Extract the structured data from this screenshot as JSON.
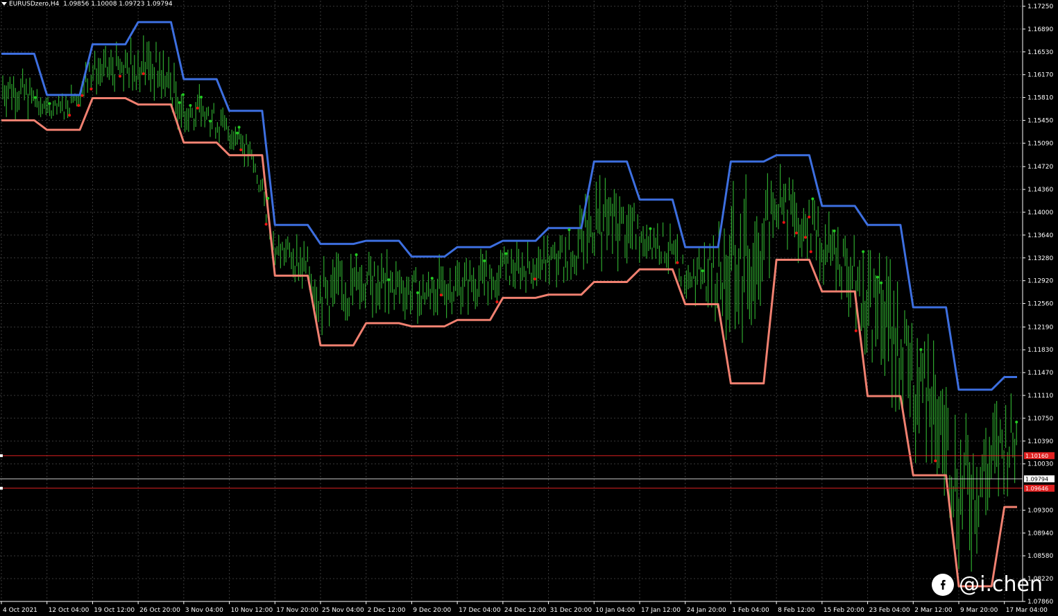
{
  "header": {
    "symbol_info": "EURUSDzero,H4",
    "ohlc": "1.09856 1.10008 1.09723 1.09794"
  },
  "colors": {
    "background": "#000000",
    "grid": "#3a3a3a",
    "upper_band": "#3d6fe0",
    "lower_band": "#f08070",
    "candles": "#2ea82e",
    "up_dot": "#22cc22",
    "down_dot": "#ee1111",
    "level_line": "#e02020",
    "current_line": "#c8c8c8"
  },
  "price_axis": {
    "labels": [
      "1.17250",
      "1.16890",
      "1.16530",
      "1.16170",
      "1.15810",
      "1.15450",
      "1.15090",
      "1.14720",
      "1.14360",
      "1.14000",
      "1.13640",
      "1.13280",
      "1.12920",
      "1.12560",
      "1.12190",
      "1.11830",
      "1.11470",
      "1.11110",
      "1.10750",
      "1.10390",
      "1.10030",
      "1.09300",
      "1.08940",
      "1.08580",
      "1.08220",
      "1.07860"
    ]
  },
  "time_axis": {
    "labels": [
      "4 Oct 2021",
      "12 Oct 04:00",
      "19 Oct 12:00",
      "26 Oct 20:00",
      "3 Nov 04:00",
      "10 Nov 12:00",
      "17 Nov 20:00",
      "25 Nov 04:00",
      "2 Dec 12:00",
      "9 Dec 20:00",
      "17 Dec 04:00",
      "24 Dec 12:00",
      "31 Dec 20:00",
      "10 Jan 04:00",
      "17 Jan 12:00",
      "24 Jan 20:00",
      "1 Feb 04:00",
      "8 Feb 12:00",
      "15 Feb 20:00",
      "23 Feb 04:00",
      "2 Mar 12:00",
      "9 Mar 20:00",
      "17 Mar 04:00"
    ]
  },
  "price_tags": {
    "resistance": "1.10160",
    "current": "1.09794",
    "support": "1.09646"
  },
  "watermark": {
    "text": "@i.chen",
    "icon": "facebook-icon"
  },
  "chart_data": {
    "type": "line",
    "ylim": [
      1.0786,
      1.1725
    ],
    "x": [
      "4 Oct 2021",
      "12 Oct 04:00",
      "19 Oct 12:00",
      "26 Oct 20:00",
      "3 Nov 04:00",
      "10 Nov 12:00",
      "17 Nov 20:00",
      "25 Nov 04:00",
      "2 Dec 12:00",
      "9 Dec 20:00",
      "17 Dec 04:00",
      "24 Dec 12:00",
      "31 Dec 20:00",
      "10 Jan 04:00",
      "17 Jan 12:00",
      "24 Jan 20:00",
      "1 Feb 04:00",
      "8 Feb 12:00",
      "15 Feb 20:00",
      "23 Feb 04:00",
      "2 Mar 12:00",
      "9 Mar 20:00",
      "17 Mar 04:00"
    ],
    "series": [
      {
        "color": "#3d6fe0",
        "values": [
          1.165,
          1.1585,
          1.1665,
          1.17,
          1.161,
          1.156,
          1.138,
          1.135,
          1.1355,
          1.133,
          1.1345,
          1.1355,
          1.1375,
          1.148,
          1.142,
          1.1345,
          1.148,
          1.149,
          1.141,
          1.138,
          1.125,
          1.112,
          1.114
        ]
      },
      {
        "color": "#f08070",
        "values": [
          1.1545,
          1.153,
          1.158,
          1.157,
          1.151,
          1.149,
          1.13,
          1.119,
          1.1225,
          1.122,
          1.123,
          1.1265,
          1.127,
          1.129,
          1.131,
          1.1255,
          1.113,
          1.1325,
          1.1275,
          1.111,
          1.0985,
          1.081,
          1.0935
        ]
      }
    ],
    "levels": [
      1.1016,
      1.09794,
      1.09646
    ],
    "grid": true
  }
}
